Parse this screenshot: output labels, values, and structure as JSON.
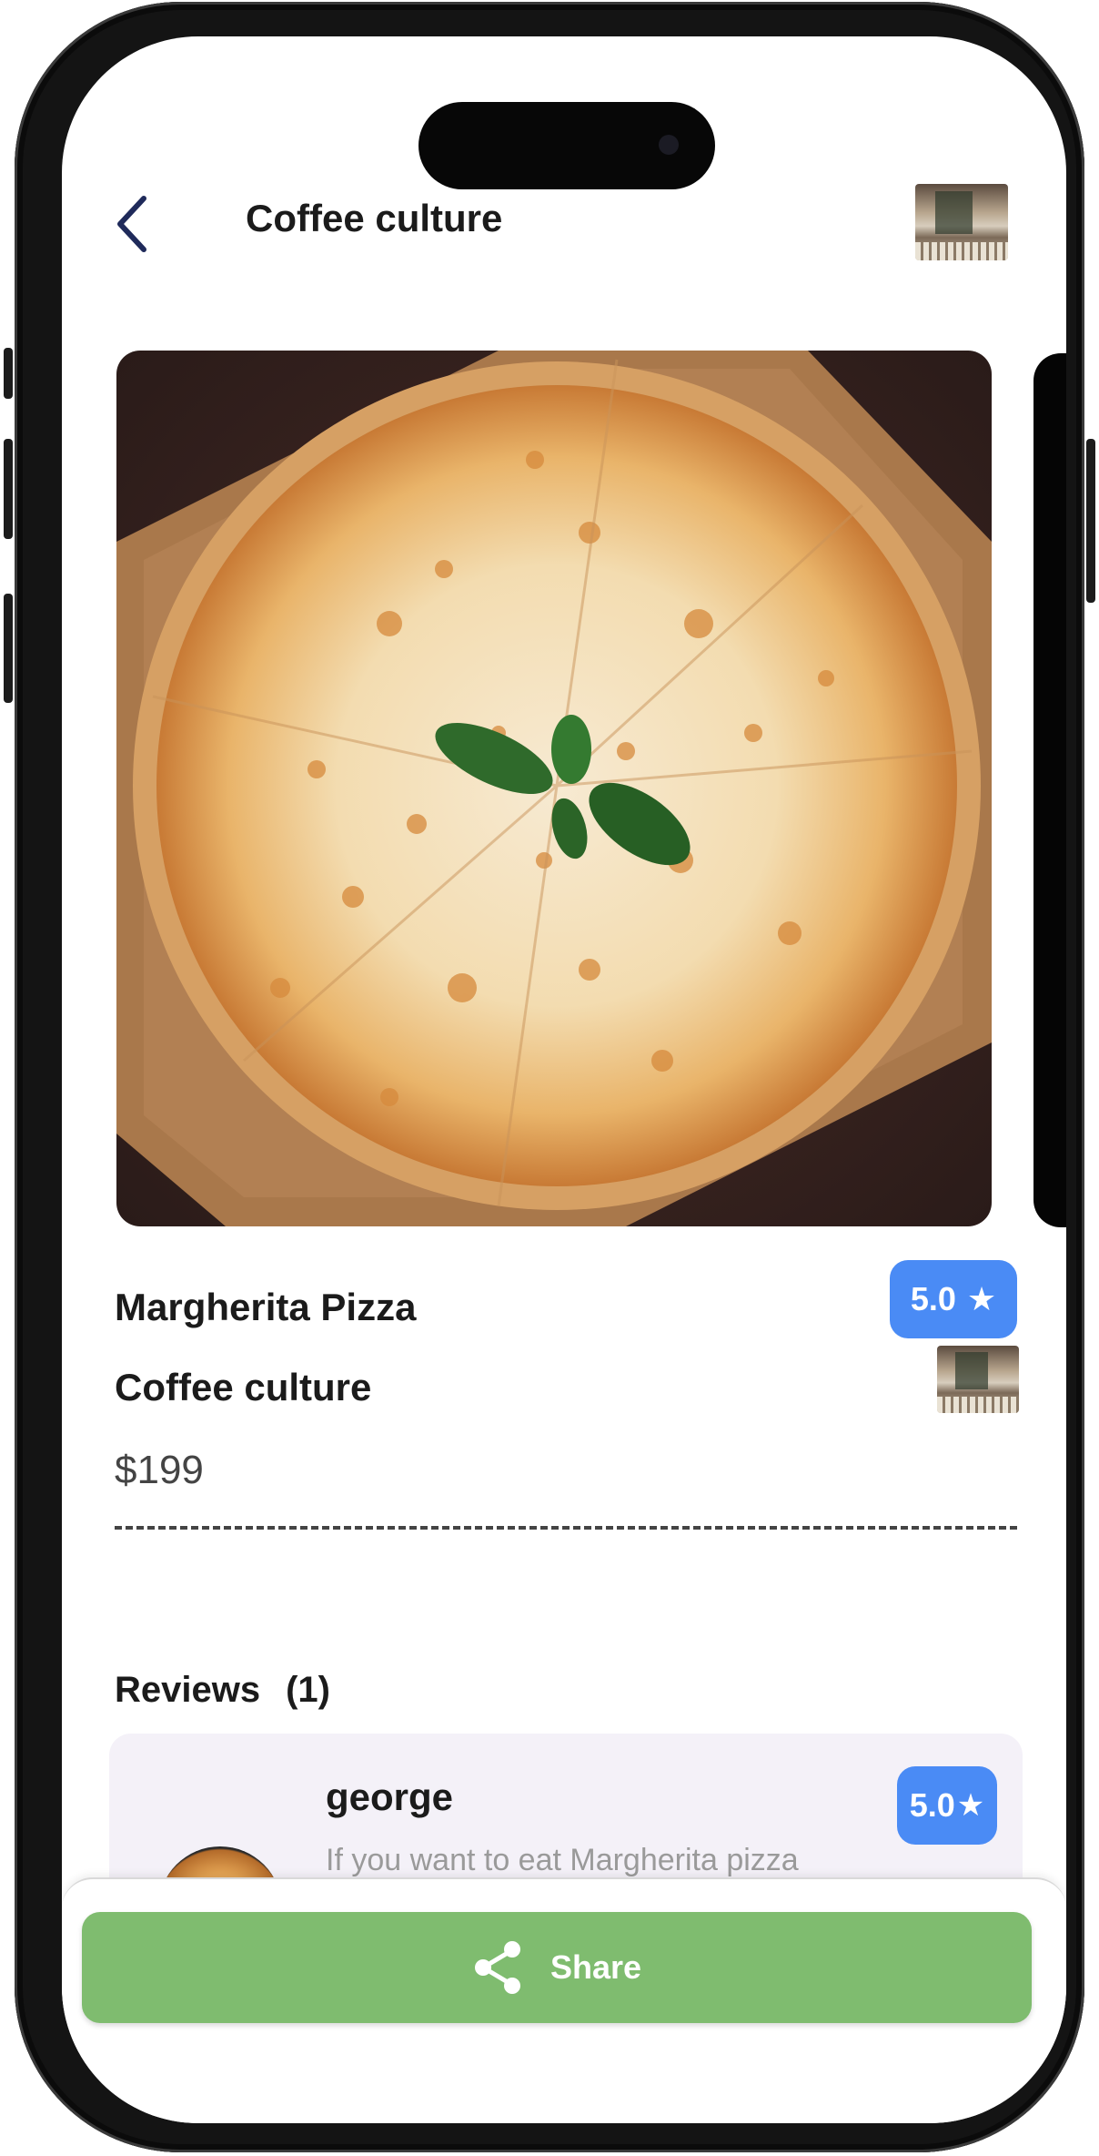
{
  "header": {
    "title": "Coffee culture",
    "back_icon": "chevron-left-icon",
    "store_thumbnail_icon": "store-photo-thumbnail"
  },
  "item": {
    "name": "Margherita Pizza",
    "store": "Coffee culture",
    "price": "$199",
    "rating": "5.0",
    "rating_star": "★",
    "image": "margherita-pizza-photo"
  },
  "reviews": {
    "title": "Reviews",
    "count": "(1)",
    "items": [
      {
        "author": "george",
        "rating": "5.0",
        "rating_star": "★",
        "text": "If you want to eat Margherita pizza"
      }
    ]
  },
  "actions": {
    "share_label": "Share",
    "share_icon": "share-icon"
  },
  "colors": {
    "rating_badge": "#4a8bf5",
    "share_button": "#7fbc6f",
    "review_card": "#f4f1f8",
    "back_icon": "#1f2a5a"
  }
}
